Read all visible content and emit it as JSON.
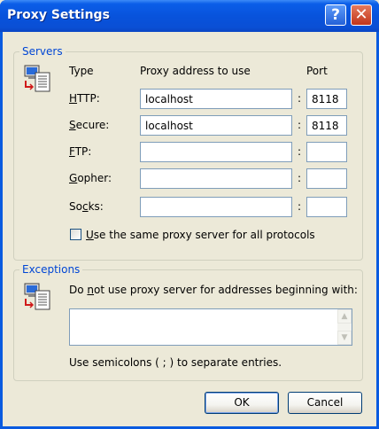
{
  "window": {
    "title": "Proxy Settings"
  },
  "titlebar": {
    "help_glyph": "?",
    "close_glyph": "✕"
  },
  "servers": {
    "legend": "Servers",
    "icon": "network-computer-icon",
    "col_type": "Type",
    "col_address": "Proxy address to use",
    "col_port": "Port",
    "rows": [
      {
        "key": "H",
        "rest": "TTP:",
        "address": "localhost",
        "port": "8118"
      },
      {
        "key": "S",
        "rest": "ecure:",
        "address": "localhost",
        "port": "8118"
      },
      {
        "key": "F",
        "rest": "TP:",
        "address": "",
        "port": ""
      },
      {
        "key": "G",
        "rest": "opher:",
        "address": "",
        "port": ""
      },
      {
        "pre": "So",
        "key": "c",
        "rest": "ks:",
        "address": "",
        "port": ""
      }
    ],
    "colon": ":",
    "same_proxy": {
      "key": "U",
      "rest": "se the same proxy server for all protocols",
      "checked": false
    }
  },
  "exceptions": {
    "legend": "Exceptions",
    "icon": "network-computer-icon",
    "label_pre": "Do ",
    "label_key": "n",
    "label_rest": "ot use proxy server for addresses beginning with:",
    "value": "",
    "hint": "Use semicolons ( ; ) to separate entries."
  },
  "buttons": {
    "ok": "OK",
    "cancel": "Cancel"
  },
  "colors": {
    "title_blue": "#0a5be0",
    "legend_blue": "#0046d5",
    "face": "#ece9d8"
  }
}
